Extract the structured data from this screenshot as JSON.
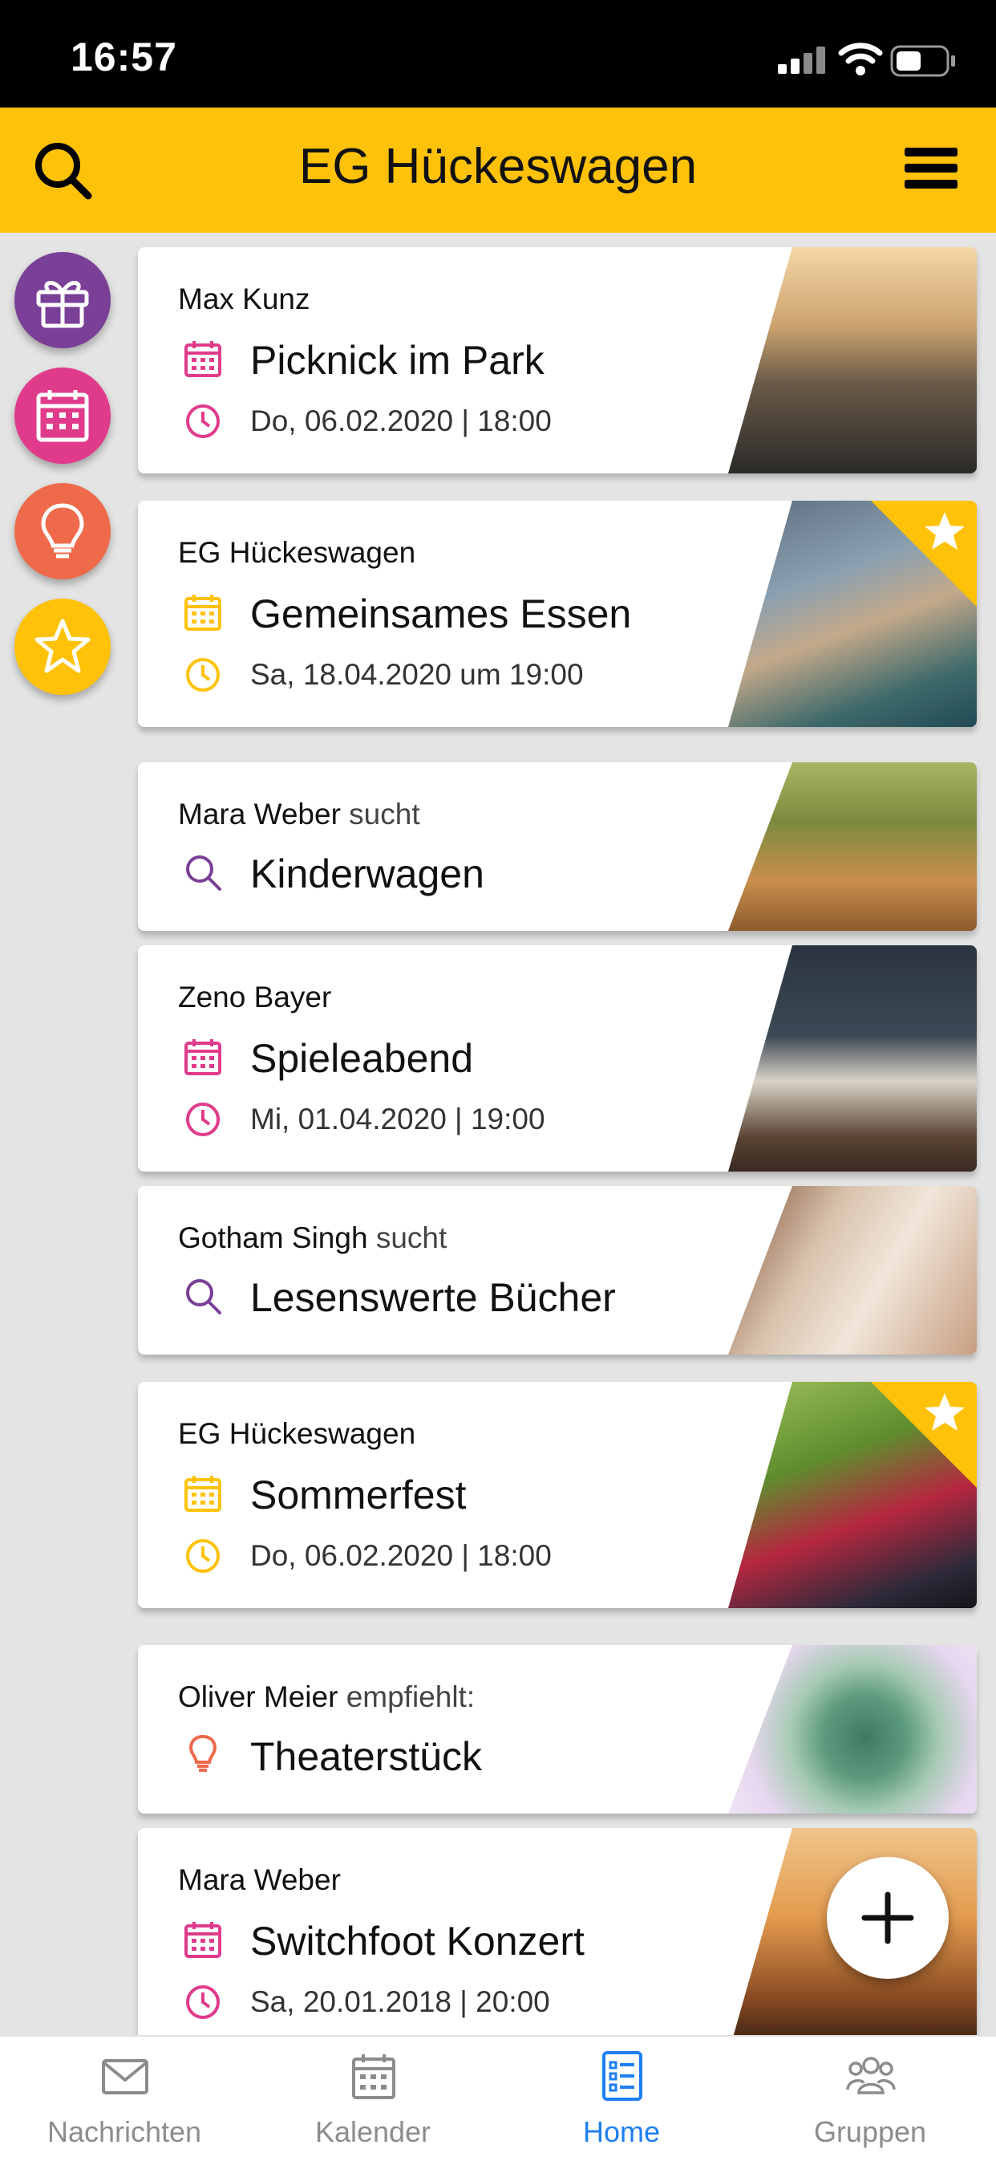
{
  "status_bar": {
    "time": "16:57"
  },
  "header": {
    "title": "EG Hückeswagen",
    "search_icon": "search-icon",
    "menu_icon": "hamburger-menu-icon"
  },
  "side_buttons": [
    {
      "name": "gift",
      "icon": "gift-icon",
      "color": "#7a3f96"
    },
    {
      "name": "calendar",
      "icon": "calendar-icon",
      "color": "#e03b8b"
    },
    {
      "name": "idea",
      "icon": "lightbulb-icon",
      "color": "#ee6a4b"
    },
    {
      "name": "favorites",
      "icon": "star-icon",
      "color": "#ffc208"
    }
  ],
  "cards": [
    {
      "author": "Max Kunz",
      "suffix": "",
      "title": "Picknick im Park",
      "date": "Do, 06.02.2020 | 18:00",
      "type": "event",
      "accent": "#e03b8b",
      "featured": false
    },
    {
      "author": "EG Hückeswagen",
      "suffix": "",
      "title": "Gemeinsames Essen",
      "date": "Sa, 18.04.2020 um 19:00",
      "type": "event",
      "accent": "#ffc208",
      "featured": true
    },
    {
      "author": "Mara Weber",
      "suffix": "sucht",
      "title": "Kinderwagen",
      "date": "",
      "type": "search",
      "accent": "#7a3f96",
      "featured": false
    },
    {
      "author": "Zeno Bayer",
      "suffix": "",
      "title": "Spieleabend",
      "date": "Mi, 01.04.2020 | 19:00",
      "type": "event",
      "accent": "#e03b8b",
      "featured": false
    },
    {
      "author": "Gotham Singh",
      "suffix": "sucht",
      "title": "Lesenswerte Bücher",
      "date": "",
      "type": "search",
      "accent": "#7a3f96",
      "featured": false
    },
    {
      "author": "EG Hückeswagen",
      "suffix": "",
      "title": "Sommerfest",
      "date": "Do, 06.02.2020 | 18:00",
      "type": "event",
      "accent": "#ffc208",
      "featured": true
    },
    {
      "author": "Oliver Meier",
      "suffix": "empfiehlt:",
      "title": "Theaterstück",
      "date": "",
      "type": "recommend",
      "accent": "#ee6a4b",
      "featured": false
    },
    {
      "author": "Mara Weber",
      "suffix": "",
      "title": "Switchfoot Konzert",
      "date": "Sa, 20.01.2018 | 20:00",
      "type": "event",
      "accent": "#e03b8b",
      "featured": false
    }
  ],
  "fab": {
    "icon": "plus-icon"
  },
  "tabbar": {
    "tabs": [
      {
        "label": "Nachrichten",
        "icon": "envelope-icon",
        "active": false
      },
      {
        "label": "Kalender",
        "icon": "calendar-icon",
        "active": false
      },
      {
        "label": "Home",
        "icon": "list-icon",
        "active": true
      },
      {
        "label": "Gruppen",
        "icon": "group-icon",
        "active": false
      }
    ],
    "active_color": "#1e7ff0"
  }
}
